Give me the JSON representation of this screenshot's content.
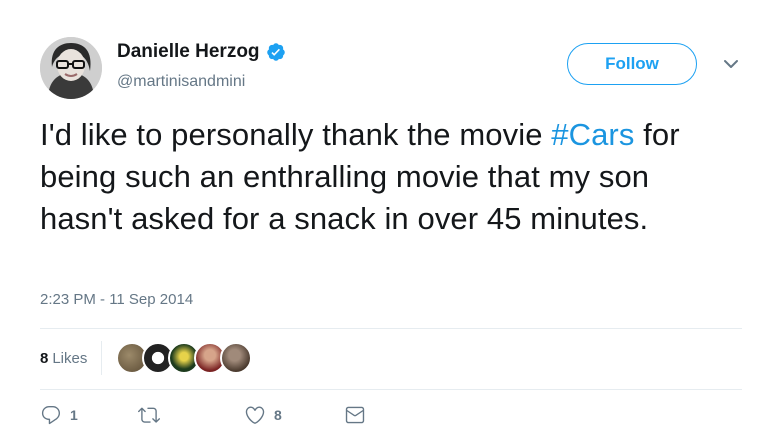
{
  "author": {
    "name": "Danielle Herzog",
    "handle": "@martinisandmini",
    "verified": true
  },
  "follow_button": {
    "label": "Follow"
  },
  "tweet": {
    "text_before": "I'd like to personally thank the movie ",
    "hashtag": "#Cars",
    "text_after": " for being such an enthralling movie that my son hasn't asked for a snack in over 45 minutes.",
    "timestamp": "2:23 PM - 11 Sep 2014"
  },
  "likes": {
    "count": "8",
    "label": "Likes"
  },
  "actions": {
    "reply_count": "1",
    "retweet_count": "",
    "like_count": "8"
  },
  "colors": {
    "accent": "#1da1f2",
    "hashtag": "#1b95e0",
    "secondary_text": "#657786"
  },
  "icons": [
    "verified-badge-icon",
    "chevron-down-icon",
    "reply-icon",
    "retweet-icon",
    "heart-icon",
    "mail-icon"
  ]
}
